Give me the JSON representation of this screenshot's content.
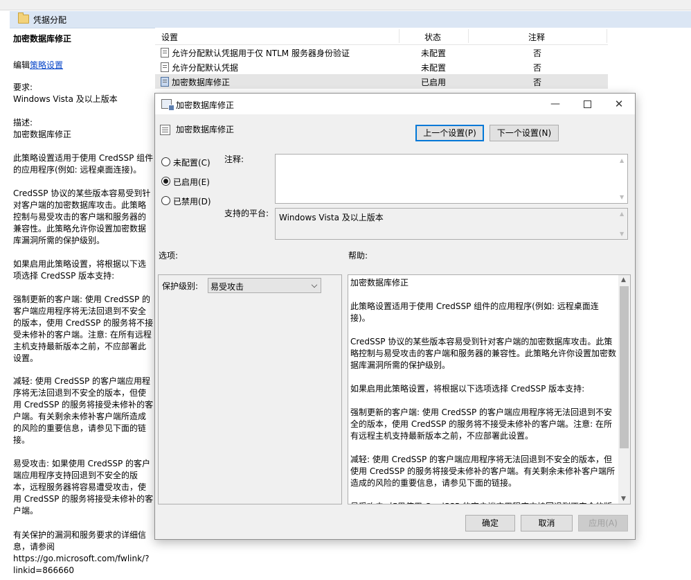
{
  "window": {
    "folder_title": "凭据分配"
  },
  "description": {
    "title": "加密数据库修正",
    "edit_prefix": "编辑",
    "edit_link": "策略设置",
    "blocks": [
      "要求:\nWindows Vista 及以上版本",
      "描述:\n加密数据库修正",
      "此策略设置适用于使用 CredSSP 组件\n的应用程序(例如: 远程桌面连接)。",
      "CredSSP 协议的某些版本容易受到针\n对客户端的加密数据库攻击。此策略\n控制与易受攻击的客户端和服务器的\n兼容性。此策略允许你设置加密数据\n库漏洞所需的保护级别。",
      "如果启用此策略设置，将根据以下选\n项选择 CredSSP 版本支持:",
      "强制更新的客户端: 使用 CredSSP 的\n客户端应用程序将无法回退到不安全\n的版本，使用 CredSSP 的服务将不接\n受未修补的客户端。注意: 在所有远程\n主机支持最新版本之前，不应部署此\n设置。",
      "减轻: 使用 CredSSP 的客户端应用程\n序将无法回退到不安全的版本，但使\n用 CredSSP 的服务将接受未修补的客\n户端。有关剩余未修补客户端所造成\n的风险的重要信息，请参见下面的链\n接。",
      "易受攻击: 如果使用 CredSSP 的客户\n端应用程序支持回退到不安全的版\n本，远程服务器将容易遭受攻击，使\n用 CredSSP 的服务将接受未修补的客\n户端。",
      "有关保护的漏洞和服务要求的详细信\n息，请参阅\nhttps://go.microsoft.com/fwlink/?\nlinkid=866660"
    ]
  },
  "list": {
    "columns": [
      "设置",
      "状态",
      "注释"
    ],
    "rows": [
      {
        "name": "允许分配默认凭据用于仅 NTLM 服务器身份验证",
        "state": "未配置",
        "note": "否"
      },
      {
        "name": "允许分配默认凭据",
        "state": "未配置",
        "note": "否"
      },
      {
        "name": "加密数据库修正",
        "state": "已启用",
        "note": "否"
      }
    ]
  },
  "dialog": {
    "title": "加密数据库修正",
    "setting_name": "加密数据库修正",
    "prev_button": "上一个设置(P)",
    "next_button": "下一个设置(N)",
    "radio_not_configured": "未配置(C)",
    "radio_enabled": "已启用(E)",
    "radio_disabled": "已禁用(D)",
    "comment_label": "注释:",
    "comment_value": "",
    "platform_label": "支持的平台:",
    "platform_value": "Windows Vista 及以上版本",
    "options_label": "选项:",
    "help_label": "帮助:",
    "protection_label": "保护级别:",
    "protection_value": "易受攻击",
    "help_text": "加密数据库修正\n\n此策略设置适用于使用 CredSSP 组件的应用程序(例如: 远程桌面连接)。\n\nCredSSP 协议的某些版本容易受到针对客户端的加密数据库攻击。此策\n略控制与易受攻击的客户端和服务器的兼容性。此策略允许你设置加密数\n据库漏洞所需的保护级别。\n\n如果启用此策略设置，将根据以下选项选择 CredSSP 版本支持:\n\n强制更新的客户端: 使用 CredSSP 的客户端应用程序将无法回退到不安\n全的版本，使用 CredSSP 的服务将不接受未修补的客户端。注意: 在所\n有远程主机支持最新版本之前，不应部署此设置。\n\n减轻: 使用 CredSSP 的客户端应用程序将无法回退到不安全的版本，但\n使用 CredSSP 的服务将接受未修补的客户端。有关剩余未修补客户端所\n造成的风险的重要信息，请参见下面的链接。\n\n易受攻击: 如果使用 CredSSP 的客户端应用程序支持回退到不安全的版\n本，远程服务器将容易遭受攻击，使用 CredSSP 的服务将接受未修补的",
    "ok_button": "确定",
    "cancel_button": "取消",
    "apply_button": "应用(A)"
  }
}
